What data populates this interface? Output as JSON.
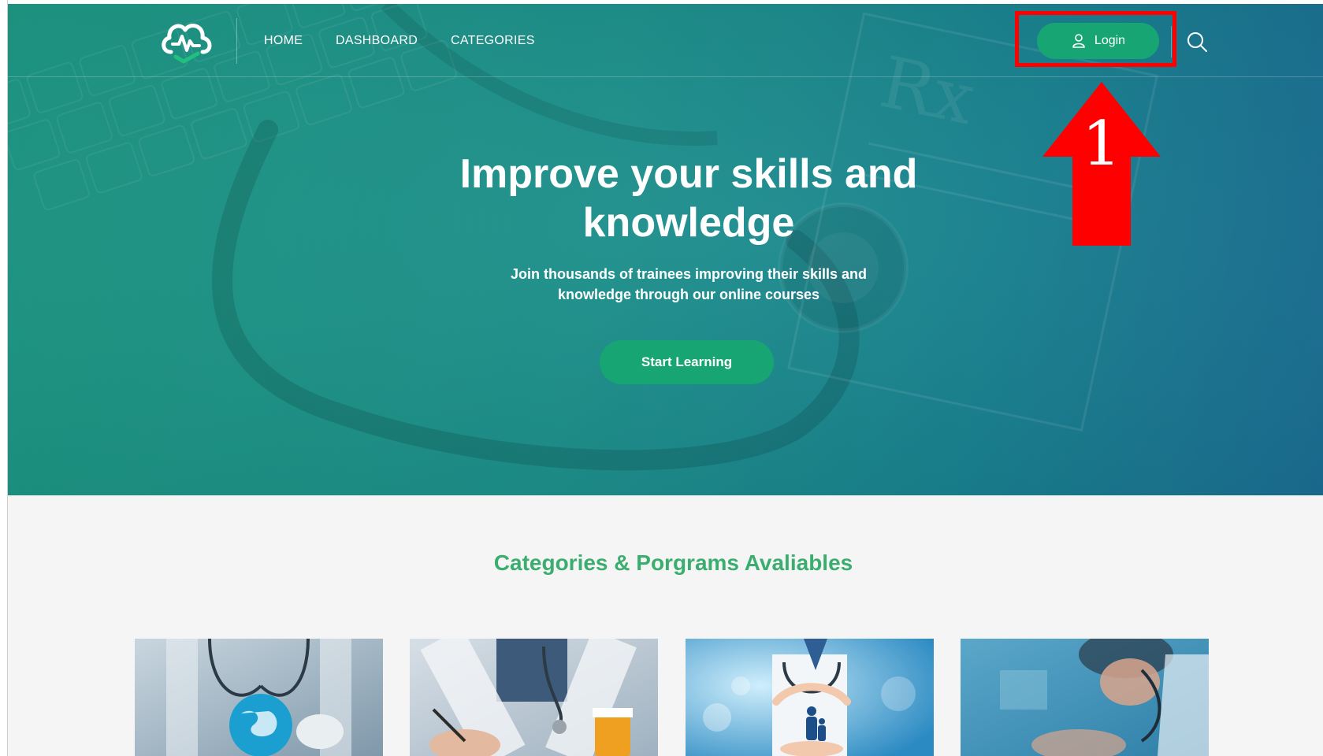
{
  "nav": {
    "links": [
      "HOME",
      "DASHBOARD",
      "CATEGORIES"
    ],
    "login_label": "Login",
    "logo_icon": "heartbeat-cloud-logo",
    "search_icon": "search-icon"
  },
  "hero": {
    "title_line1": "Improve your skills and",
    "title_line2": "knowledge",
    "subtitle_line1": "Join thousands of trainees improving their skills and",
    "subtitle_line2": "knowledge through our online courses",
    "cta_label": "Start Learning",
    "background": "stethoscope-keyboard-prescription"
  },
  "annotation": {
    "step_number": "1",
    "color": "#ff0000"
  },
  "categories": {
    "title": "Categories & Porgrams Avaliables",
    "cards": [
      {
        "image": "doctor-holding-globe"
      },
      {
        "image": "doctor-writing-prescription"
      },
      {
        "image": "doctor-protecting-family"
      },
      {
        "image": "doctor-with-stethoscope-patient"
      }
    ]
  },
  "colors": {
    "accent_green": "#17a673",
    "title_green": "#3aad6f",
    "hero_teal": "#1a8f8a"
  }
}
